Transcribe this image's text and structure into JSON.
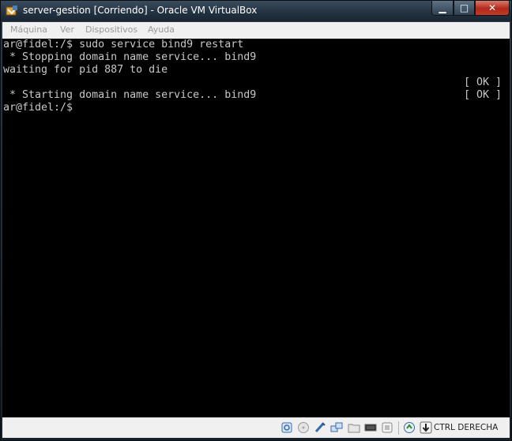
{
  "window": {
    "title": "server-gestion [Corriendo] - Oracle VM VirtualBox",
    "controls": {
      "minimize": "▁",
      "maximize": "□",
      "close": "✕"
    }
  },
  "menu": {
    "items": [
      "Máquina",
      "Ver",
      "Dispositivos",
      "Ayuda"
    ]
  },
  "terminal": {
    "lines": [
      "ar@fidel:/$ sudo service bind9 restart",
      " * Stopping domain name service... bind9",
      "waiting for pid 887 to die",
      "",
      " * Starting domain name service... bind9",
      "ar@fidel:/$"
    ],
    "status_ok_1": "[ OK ]",
    "status_ok_2": "[ OK ]",
    "colors": {
      "background": "#000000",
      "foreground": "#c8c8c8"
    }
  },
  "statusbar": {
    "icons": [
      "hard-disk-icon",
      "optical-drive-icon",
      "usb-icon",
      "network-icon",
      "shared-folder-icon",
      "display-icon",
      "video-capture-icon",
      "mouse-integration-icon",
      "host-key-arrow-icon"
    ],
    "host_key": "CTRL DERECHA"
  }
}
